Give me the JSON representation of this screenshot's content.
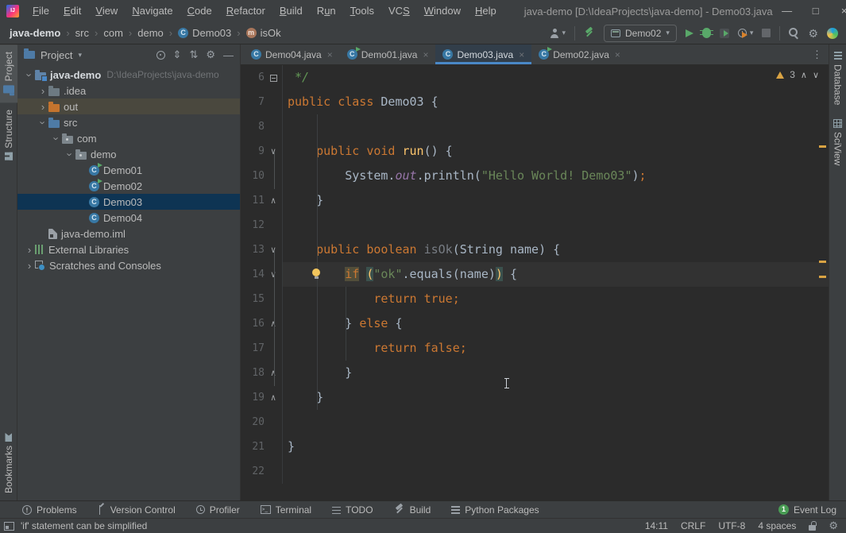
{
  "window": {
    "title": "java-demo [D:\\IdeaProjects\\java-demo] - Demo03.java",
    "controls": {
      "minimize": "—",
      "maximize": "□",
      "close": "×"
    }
  },
  "menu_items": [
    {
      "label": "File",
      "m": 0
    },
    {
      "label": "Edit",
      "m": 0
    },
    {
      "label": "View",
      "m": 0
    },
    {
      "label": "Navigate",
      "m": 0
    },
    {
      "label": "Code",
      "m": 0
    },
    {
      "label": "Refactor",
      "m": 0
    },
    {
      "label": "Build",
      "m": 0
    },
    {
      "label": "Run",
      "m": 1
    },
    {
      "label": "Tools",
      "m": 0
    },
    {
      "label": "VCS",
      "m": 2
    },
    {
      "label": "Window",
      "m": 0
    },
    {
      "label": "Help",
      "m": 0
    }
  ],
  "breadcrumbs": [
    {
      "label": "java-demo",
      "bold": true
    },
    {
      "label": "src"
    },
    {
      "label": "com"
    },
    {
      "label": "demo"
    },
    {
      "label": "Demo03",
      "icon": "class"
    },
    {
      "label": "isOk",
      "icon": "method"
    }
  ],
  "toolbar": {
    "run_config": "Demo02"
  },
  "project": {
    "title": "Project",
    "tree": [
      {
        "depth": 0,
        "arrow": "open",
        "icon": "f-root",
        "label": "java-demo",
        "bold": true,
        "extra": "D:\\IdeaProjects\\java-demo"
      },
      {
        "depth": 1,
        "arrow": "closed",
        "icon": "f-idea",
        "label": ".idea"
      },
      {
        "depth": 1,
        "arrow": "closed",
        "icon": "f-out",
        "label": "out",
        "state": "hovered"
      },
      {
        "depth": 1,
        "arrow": "open",
        "icon": "f-src",
        "label": "src"
      },
      {
        "depth": 2,
        "arrow": "open",
        "icon": "f-pkg",
        "label": "com"
      },
      {
        "depth": 3,
        "arrow": "open",
        "icon": "f-pkg",
        "label": "demo"
      },
      {
        "depth": 4,
        "icon": "class-run",
        "label": "Demo01"
      },
      {
        "depth": 4,
        "icon": "class-run",
        "label": "Demo02"
      },
      {
        "depth": 4,
        "icon": "class",
        "label": "Demo03",
        "state": "selected"
      },
      {
        "depth": 4,
        "icon": "class",
        "label": "Demo04"
      },
      {
        "depth": 1,
        "icon": "iml",
        "label": "java-demo.iml"
      },
      {
        "depth": 0,
        "arrow": "closed",
        "icon": "library",
        "label": "External Libraries"
      },
      {
        "depth": 0,
        "arrow": "closed",
        "icon": "scratch",
        "label": "Scratches and Consoles"
      }
    ]
  },
  "tabs": [
    {
      "label": "Demo04.java",
      "icon": "class",
      "close": "×"
    },
    {
      "label": "Demo01.java",
      "icon": "class-run",
      "close": "×"
    },
    {
      "label": "Demo03.java",
      "icon": "class",
      "close": "×",
      "active": true
    },
    {
      "label": "Demo02.java",
      "icon": "class-run",
      "close": "×"
    }
  ],
  "editor": {
    "warning_count": "3",
    "lines": [
      {
        "n": "6",
        "fold": "box",
        "seg": [
          [
            "cmt",
            " */"
          ]
        ]
      },
      {
        "n": "7",
        "seg": [
          [
            "kw",
            "public class "
          ],
          [
            "plain",
            "Demo03 {"
          ]
        ]
      },
      {
        "n": "8",
        "seg": []
      },
      {
        "n": "9",
        "fold": "down",
        "seg": [
          [
            "plain",
            "    "
          ],
          [
            "kw",
            "public void "
          ],
          [
            "decl",
            "run"
          ],
          [
            "plain",
            "() {"
          ]
        ]
      },
      {
        "n": "10",
        "seg": [
          [
            "plain",
            "        System."
          ],
          [
            "field",
            "out"
          ],
          [
            "plain",
            ".println("
          ],
          [
            "str",
            "\"Hello World! Demo03\""
          ],
          [
            "plain",
            ")"
          ],
          [
            "kw",
            ";"
          ]
        ]
      },
      {
        "n": "11",
        "fold": "up",
        "seg": [
          [
            "plain",
            "    }"
          ]
        ]
      },
      {
        "n": "12",
        "seg": []
      },
      {
        "n": "13",
        "fold": "down",
        "seg": [
          [
            "plain",
            "    "
          ],
          [
            "kw",
            "public boolean "
          ],
          [
            "gray",
            "isOk"
          ],
          [
            "plain",
            "(String name) {"
          ]
        ]
      },
      {
        "n": "14",
        "fold": "down",
        "cur": true,
        "bulb": true,
        "seg": [
          [
            "plain",
            "        "
          ],
          [
            "kw warnbg",
            "if"
          ],
          [
            "plain",
            " "
          ],
          [
            "brace",
            "("
          ],
          [
            "str",
            "\"ok\""
          ],
          [
            "plain",
            ".equals(name)"
          ],
          [
            "brace",
            ")"
          ],
          [
            "plain",
            " {"
          ]
        ]
      },
      {
        "n": "15",
        "seg": [
          [
            "plain",
            "            "
          ],
          [
            "kw",
            "return true;"
          ]
        ]
      },
      {
        "n": "16",
        "fold": "up",
        "seg": [
          [
            "plain",
            "        } "
          ],
          [
            "kw",
            "else"
          ],
          [
            "plain",
            " {"
          ]
        ]
      },
      {
        "n": "17",
        "seg": [
          [
            "plain",
            "            "
          ],
          [
            "kw",
            "return false;"
          ]
        ]
      },
      {
        "n": "18",
        "fold": "up",
        "seg": [
          [
            "plain",
            "        }"
          ]
        ]
      },
      {
        "n": "19",
        "fold": "up",
        "seg": [
          [
            "plain",
            "    }"
          ]
        ]
      },
      {
        "n": "20",
        "seg": []
      },
      {
        "n": "21",
        "seg": [
          [
            "plain",
            "}"
          ]
        ]
      },
      {
        "n": "22",
        "seg": []
      }
    ]
  },
  "left_bar": {
    "top": [
      {
        "label": "Project",
        "icon": "folder",
        "active": true
      },
      {
        "label": "Structure",
        "icon": "structure"
      }
    ],
    "bottom": [
      {
        "label": "Bookmarks",
        "icon": "bookmark"
      }
    ]
  },
  "right_bar": [
    {
      "label": "Database",
      "icon": "database"
    },
    {
      "label": "SciView",
      "icon": "grid"
    }
  ],
  "bottom_bar": {
    "buttons": [
      {
        "label": "Problems",
        "icon": "problems"
      },
      {
        "label": "Version Control",
        "icon": "branch"
      },
      {
        "label": "Profiler",
        "icon": "clock"
      },
      {
        "label": "Terminal",
        "icon": "terminal"
      },
      {
        "label": "TODO",
        "icon": "todo"
      },
      {
        "label": "Build",
        "icon": "hammer"
      },
      {
        "label": "Python Packages",
        "icon": "packages"
      }
    ],
    "event_log": {
      "label": "Event Log",
      "badge": "1"
    }
  },
  "status_bar": {
    "message": "'if' statement can be simplified",
    "items": [
      "14:11",
      "CRLF",
      "UTF-8",
      "4 spaces"
    ]
  },
  "colors": {
    "accent_blue": "#4A88C7",
    "tree_selection": "#0e3453",
    "tree_hover": "#4a483e",
    "warning_highlight": "#524e3a",
    "brace_match": "#3b514d",
    "error_stripe": "#D9A343",
    "keyword": "#cc7832",
    "string": "#6a8759",
    "comment": "#629755",
    "field": "#9876aa",
    "method_decl": "#ffc66d",
    "run_green": "#59A869"
  }
}
